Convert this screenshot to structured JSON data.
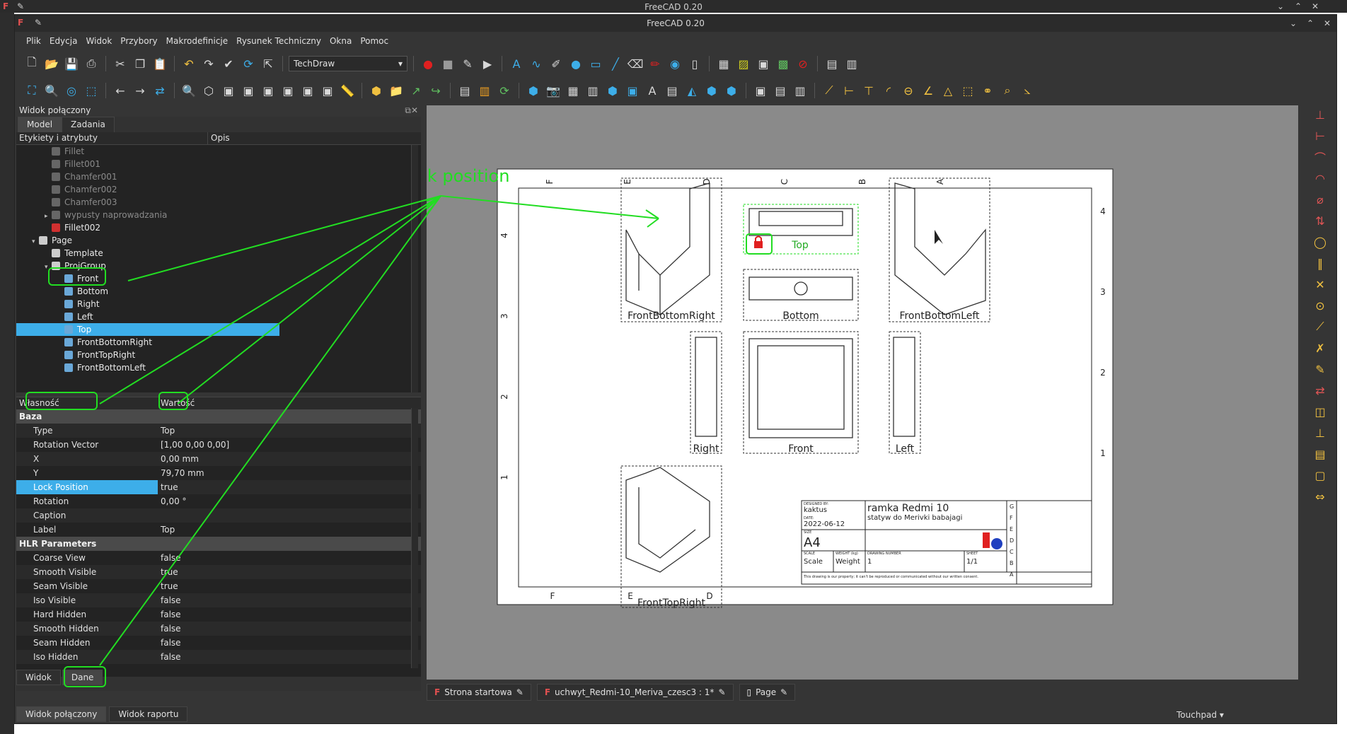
{
  "outer_window": {
    "title": "FreeCAD 0.20"
  },
  "window": {
    "title": "FreeCAD 0.20"
  },
  "menu": [
    "Plik",
    "Edycja",
    "Widok",
    "Przybory",
    "Makrodefinicje",
    "Rysunek Techniczny",
    "Okna",
    "Pomoc"
  ],
  "toolbar": {
    "workbench": "TechDraw"
  },
  "combo_view": {
    "title": "Widok połączony",
    "tabs": [
      "Model",
      "Zadania"
    ],
    "tree_columns": [
      "Etykiety i atrybuty",
      "Opis"
    ],
    "tree": [
      {
        "label": "Fillet",
        "indent": 2,
        "dim": true
      },
      {
        "label": "Fillet001",
        "indent": 2,
        "dim": true
      },
      {
        "label": "Chamfer001",
        "indent": 2,
        "dim": true
      },
      {
        "label": "Chamfer002",
        "indent": 2,
        "dim": true
      },
      {
        "label": "Chamfer003",
        "indent": 2,
        "dim": true
      },
      {
        "label": "wypusty naprowadzania",
        "indent": 2,
        "dim": true,
        "toggle": "right"
      },
      {
        "label": "Fillet002",
        "indent": 2
      },
      {
        "label": "Page",
        "indent": 1,
        "toggle": "down"
      },
      {
        "label": "Template",
        "indent": 2
      },
      {
        "label": "ProjGroup",
        "indent": 2,
        "toggle": "down"
      },
      {
        "label": "Front",
        "indent": 3
      },
      {
        "label": "Bottom",
        "indent": 3
      },
      {
        "label": "Right",
        "indent": 3
      },
      {
        "label": "Left",
        "indent": 3
      },
      {
        "label": "Top",
        "indent": 3,
        "selected": true
      },
      {
        "label": "FrontBottomRight",
        "indent": 3
      },
      {
        "label": "FrontTopRight",
        "indent": 3
      },
      {
        "label": "FrontBottomLeft",
        "indent": 3
      }
    ],
    "prop_columns": [
      "Własność",
      "Wartość"
    ],
    "groups": [
      {
        "name": "Baza",
        "rows": [
          {
            "key": "Type",
            "value": "Top"
          },
          {
            "key": "Rotation Vector",
            "value": "[1,00 0,00 0,00]"
          },
          {
            "key": "X",
            "value": "0,00 mm"
          },
          {
            "key": "Y",
            "value": "79,70 mm"
          },
          {
            "key": "Lock Position",
            "value": "true",
            "selected": true
          },
          {
            "key": "Rotation",
            "value": "0,00 °"
          },
          {
            "key": "Caption",
            "value": ""
          },
          {
            "key": "Label",
            "value": "Top"
          }
        ]
      },
      {
        "name": "HLR Parameters",
        "rows": [
          {
            "key": "Coarse View",
            "value": "false"
          },
          {
            "key": "Smooth Visible",
            "value": "true"
          },
          {
            "key": "Seam Visible",
            "value": "true"
          },
          {
            "key": "Iso Visible",
            "value": "false"
          },
          {
            "key": "Hard Hidden",
            "value": "false"
          },
          {
            "key": "Smooth Hidden",
            "value": "false"
          },
          {
            "key": "Seam Hidden",
            "value": "false"
          },
          {
            "key": "Iso Hidden",
            "value": "false"
          }
        ]
      }
    ],
    "view_tabs": [
      "Widok",
      "Dane"
    ],
    "dock_tabs": [
      "Widok połączony",
      "Widok raportu"
    ]
  },
  "drawing": {
    "col_labels_top": [
      "F",
      "E",
      "D",
      "C",
      "B",
      "A"
    ],
    "col_labels_bottom": [
      "F",
      "E",
      "D"
    ],
    "row_labels": [
      "4",
      "3",
      "2",
      "1"
    ],
    "views": [
      "Top",
      "FrontBottomRight",
      "Bottom",
      "FrontBottomLeft",
      "Right",
      "Front",
      "Left",
      "FrontTopRight"
    ],
    "title_block": {
      "designed_by_label": "DESIGNED BY:",
      "designed_by": "kaktus",
      "date_label": "DATE:",
      "date": "2022-06-12",
      "size_label": "SIZE",
      "size": "A4",
      "title": "ramka Redmi 10",
      "subtitle": "statyw do Merivki babajagi",
      "scale_label": "SCALE",
      "scale": "Scale",
      "weight_label": "WEIGHT (kg)",
      "weight": "Weight",
      "drawing_number_label": "DRAWING NUMBER",
      "drawing_number": "1",
      "sheet_label": "SHEET",
      "sheet": "1/1",
      "notice": "This drawing is our property; it can't be reproduced or communicated without our written consent.",
      "revisions": [
        "G",
        "F",
        "E",
        "D",
        "C",
        "B",
        "A"
      ]
    },
    "annotation": "Lock position"
  },
  "doc_tabs": [
    "Strona startowa",
    "uchwyt_Redmi-10_Meriva_czesc3 : 1*",
    "Page"
  ],
  "status": {
    "nav": "Touchpad"
  },
  "colors": {
    "accent": "#3daee9",
    "annotation": "#22dd22",
    "lock": "#e02020"
  }
}
